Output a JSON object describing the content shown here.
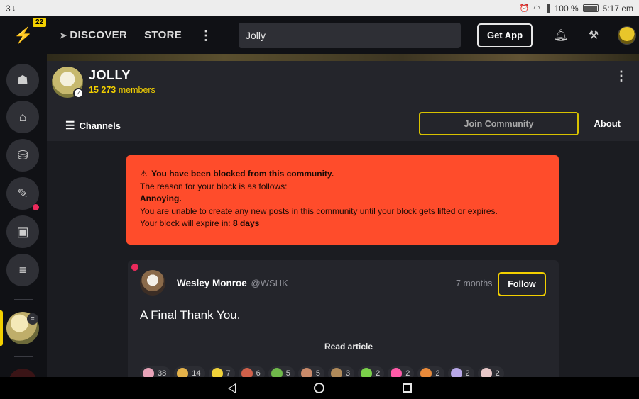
{
  "status_bar": {
    "left_text": "3",
    "battery": "100 %",
    "time": "5:17 em"
  },
  "topbar": {
    "badge": "22",
    "discover_label": "DISCOVER",
    "store_label": "STORE",
    "search_value": "Jolly",
    "get_app_label": "Get App",
    "icons": [
      "bell-icon",
      "people-icon",
      "avatar"
    ]
  },
  "community": {
    "name": "JOLLY",
    "member_count": "15 273",
    "members_label": "members",
    "channels_label": "Channels",
    "join_label": "Join Community",
    "about_label": "About"
  },
  "alert": {
    "heading": "You have been blocked from this community.",
    "reason_intro": "The reason for your block is as follows:",
    "reason": "Annoying.",
    "explanation": "You are unable to create any new posts in this community until your block gets lifted or expires.",
    "expiry_prefix": "Your block will expire in:",
    "expiry_value": "8 days"
  },
  "post": {
    "author": "Wesley Monroe",
    "handle": "@WSHK",
    "time": "7 months",
    "follow_label": "Follow",
    "title": "A Final Thank You.",
    "read_label": "Read article",
    "reactions": [
      {
        "count": "38",
        "color": "#e8a3b8"
      },
      {
        "count": "14",
        "color": "#e4b24a"
      },
      {
        "count": "7",
        "color": "#f0d23a"
      },
      {
        "count": "6",
        "color": "#d0604a"
      },
      {
        "count": "5",
        "color": "#6fb84a"
      },
      {
        "count": "5",
        "color": "#c98a6a"
      },
      {
        "count": "3",
        "color": "#b08a5a"
      },
      {
        "count": "2",
        "color": "#7ad04a"
      },
      {
        "count": "2",
        "color": "#ff5aa8"
      },
      {
        "count": "2",
        "color": "#e88a3a"
      },
      {
        "count": "2",
        "color": "#b8a8e8"
      },
      {
        "count": "2",
        "color": "#e8c8c8"
      }
    ]
  },
  "accent_colors": {
    "brand_yellow": "#f3d000",
    "alert_red": "#ff4c2b",
    "notification_pink": "#ec2a5c"
  }
}
